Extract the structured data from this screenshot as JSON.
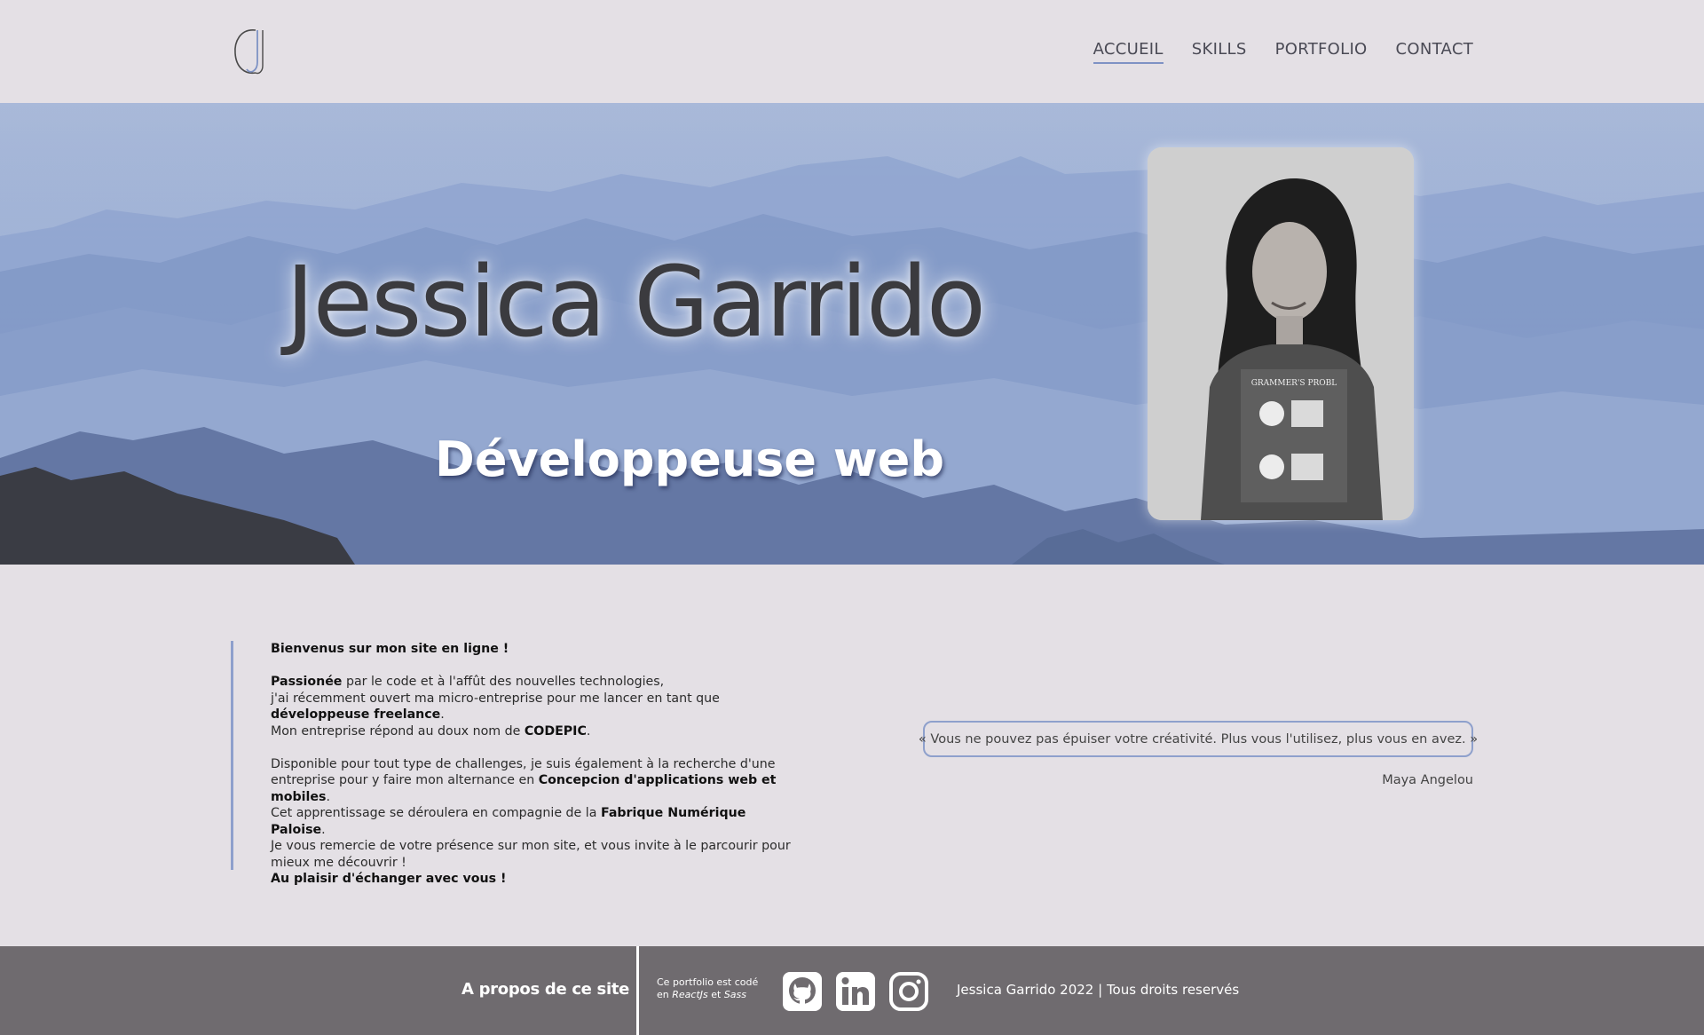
{
  "header": {
    "logo_icon": "jg-monogram-icon",
    "nav": [
      {
        "label": "ACCUEIL",
        "active": true
      },
      {
        "label": "SKILLS",
        "active": false
      },
      {
        "label": "PORTFOLIO",
        "active": false
      },
      {
        "label": "CONTACT",
        "active": false
      }
    ]
  },
  "hero": {
    "name": "Jessica Garrido",
    "subtitle": "Développeuse web",
    "background": "misty-blue-mountains",
    "portrait": "portrait-photo"
  },
  "intro": {
    "welcome": "Bienvenus sur mon site en ligne !",
    "p2_bold1": "Passionée",
    "p2_text1": " par le code et à l'affût des nouvelles technologies,",
    "p2_text2": "j'ai récemment ouvert ma micro-entreprise pour me lancer en tant que",
    "p2_bold2": "développeuse freelance",
    "p2_text3": ".",
    "p2_text4": "Mon entreprise répond au doux nom de ",
    "p2_bold3": "CODEPIC",
    "p2_text5": ".",
    "p3_text1": "Disponible pour tout type de challenges, je suis également à la recherche d'une entreprise pour y faire mon alternance en ",
    "p3_bold1": "Concepcion d'applications web et mobiles",
    "p3_text2": ".",
    "p3_text3": "Cet apprentissage se déroulera en compagnie de la ",
    "p3_bold2": "Fabrique Numérique Paloise",
    "p3_text4": ".",
    "p3_text5": "Je vous remercie de votre présence sur mon site, et vous invite à le parcourir pour mieux me découvrir !",
    "closing": "Au plaisir d'échanger avec vous !"
  },
  "quote": {
    "text": "« Vous ne pouvez pas épuiser votre créativité. Plus vous l'utilisez, plus vous en avez. »",
    "author": "Maya Angelou"
  },
  "footer": {
    "about": "A propos de ce site",
    "tech_line1": "Ce portfolio est codé",
    "tech_prefix": "en ",
    "tech_react": "ReactJs",
    "tech_and": " et ",
    "tech_sass": "Sass",
    "social": [
      "github-icon",
      "linkedin-icon",
      "instagram-icon"
    ],
    "copyright": "Jessica Garrido 2022 | Tous droits reservés"
  },
  "colors": {
    "background": "#e4e0e5",
    "accent": "#8ea0cc",
    "footer": "#6f6b6f",
    "text": "#333333"
  }
}
